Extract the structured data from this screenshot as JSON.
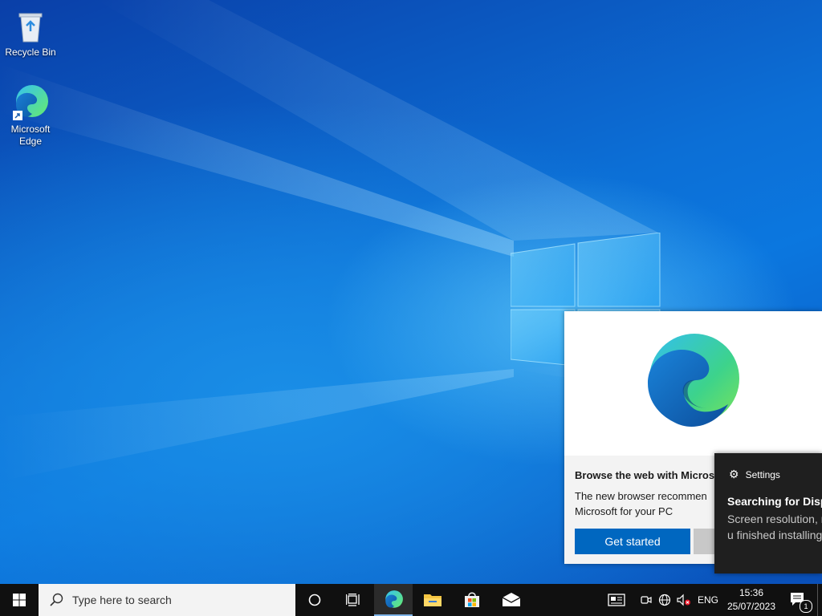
{
  "desktop": {
    "icons": [
      {
        "label": "Recycle Bin"
      },
      {
        "label": "Microsoft Edge"
      }
    ]
  },
  "edge_toast": {
    "title": "Browse the web with Micros",
    "body": "The new browser recommen Microsoft for your PC",
    "primary_button": "Get started",
    "secondary_button": ""
  },
  "settings_toast": {
    "app_name": "Settings",
    "heading": "Searching for Disp",
    "message": "Screen resolution, may be reduced u finished installing."
  },
  "taskbar": {
    "search_placeholder": "Type here to search",
    "language": "ENG",
    "time": "15:36",
    "date": "25/07/2023",
    "notification_count": "1"
  },
  "colors": {
    "accent": "#0067c0",
    "taskbar": "#101010",
    "toast_dark": "#1f1f1f"
  }
}
